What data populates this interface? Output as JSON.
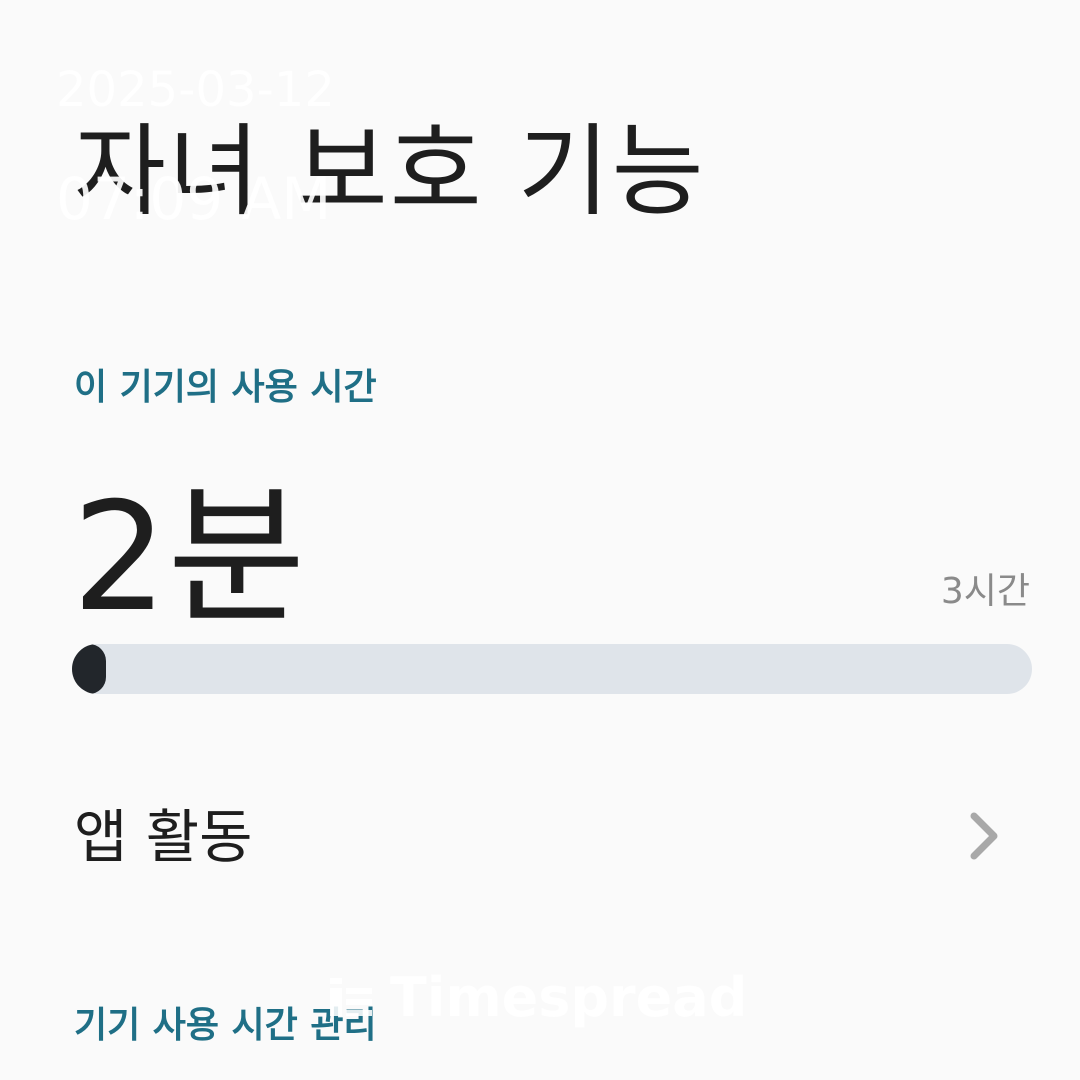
{
  "overlay": {
    "date": "2025-03-12",
    "time": "07:09 AM",
    "watermark": "Timespread"
  },
  "header": {
    "title": "자녀 보호 기능"
  },
  "device_usage": {
    "section_title": "이 기기의 사용 시간",
    "usage_value": "2분",
    "limit_label": "3시간",
    "progress_fraction": 0.011
  },
  "app_activity": {
    "label": "앱 활동",
    "icon": "chevron-right-icon"
  },
  "management": {
    "section_title": "기기 사용 시간 관리"
  },
  "colors": {
    "background": "#fafafa",
    "accent": "#1f6f86",
    "track": "#dfe4ea",
    "fill": "#22262b"
  }
}
